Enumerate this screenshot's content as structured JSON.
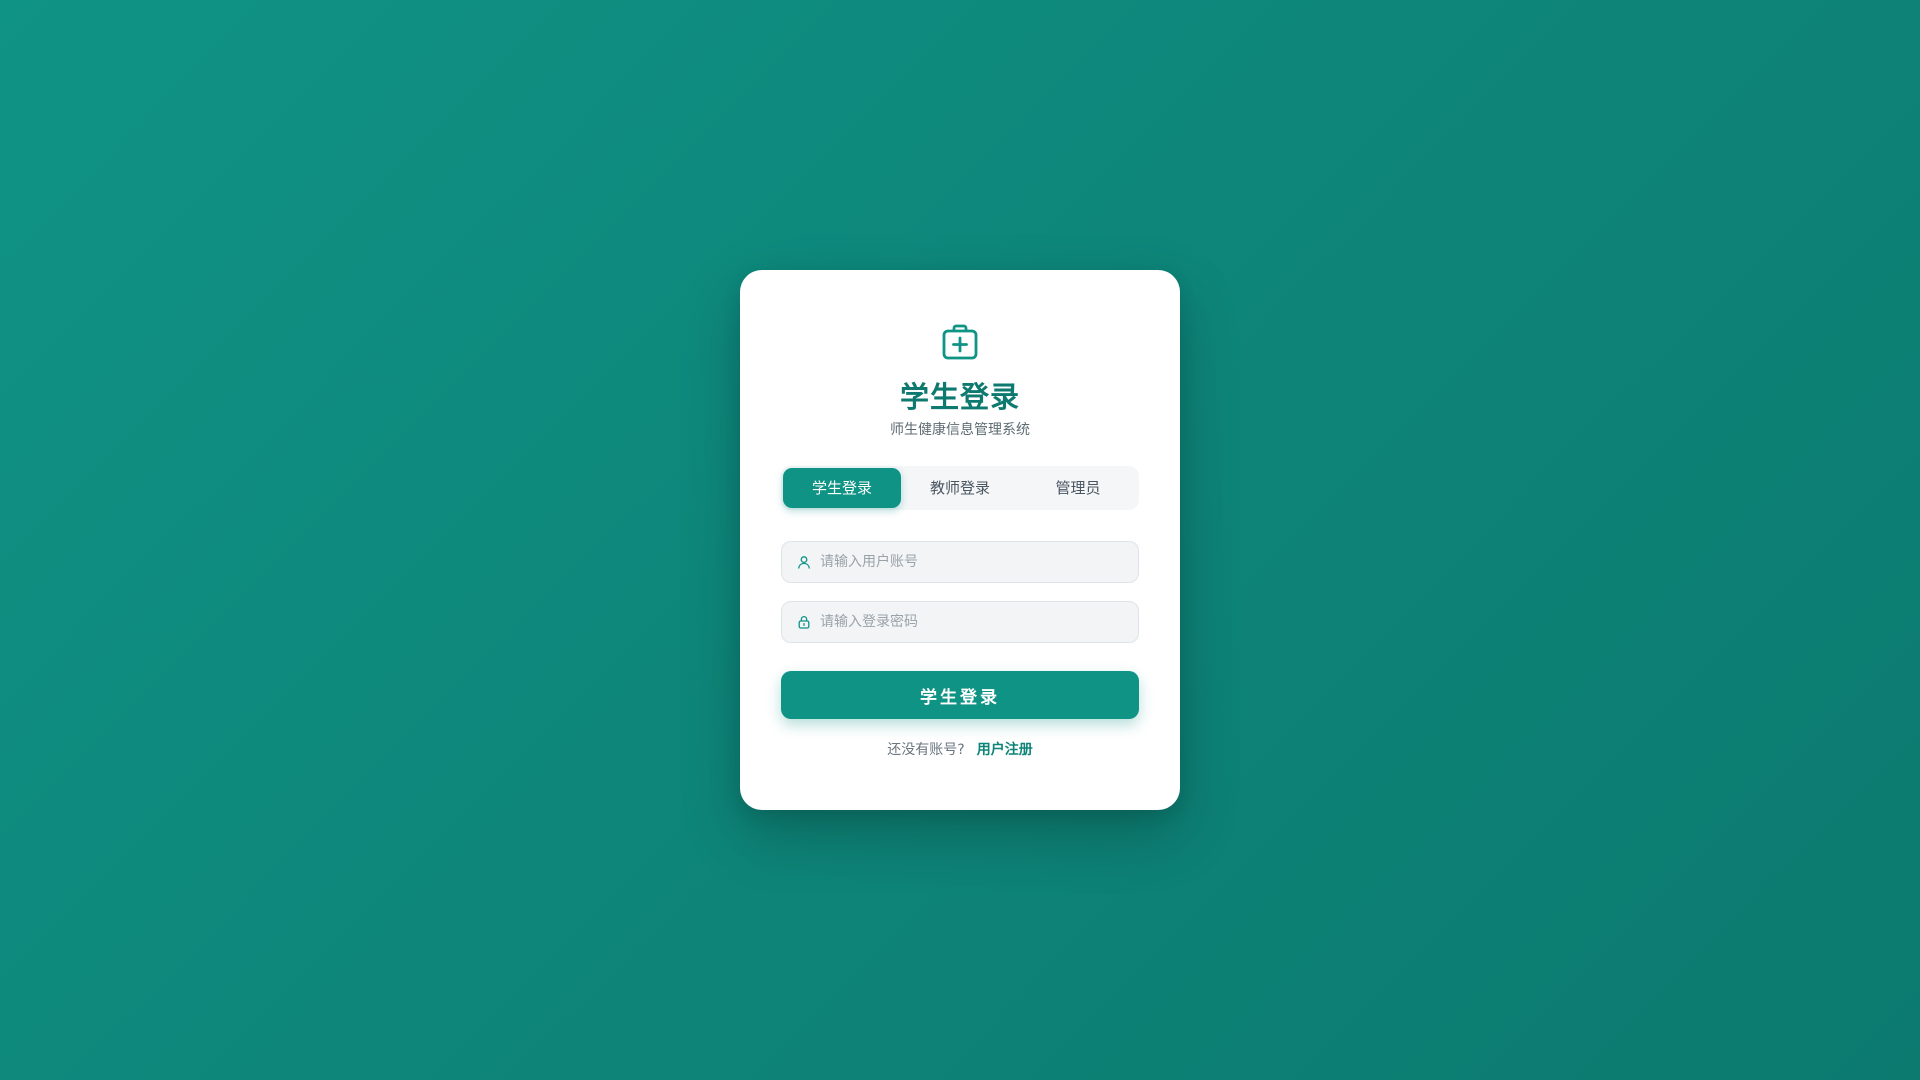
{
  "login": {
    "logo_icon": "medical-kit-icon",
    "title": "学生登录",
    "subtitle": "师生健康信息管理系统",
    "tabs": [
      {
        "label": "学生登录",
        "active": true
      },
      {
        "label": "教师登录",
        "active": false
      },
      {
        "label": "管理员",
        "active": false
      }
    ],
    "username": {
      "icon": "user-icon",
      "value": "",
      "placeholder": "请输入用户账号"
    },
    "password": {
      "icon": "lock-icon",
      "value": "",
      "placeholder": "请输入登录密码"
    },
    "submit_label": "学生登录",
    "register_prompt": "还没有账号?",
    "register_link": "用户注册"
  },
  "colors": {
    "background": "#0f9385",
    "accent": "#0f9385",
    "title": "#0e7a6f",
    "card": "#ffffff"
  }
}
